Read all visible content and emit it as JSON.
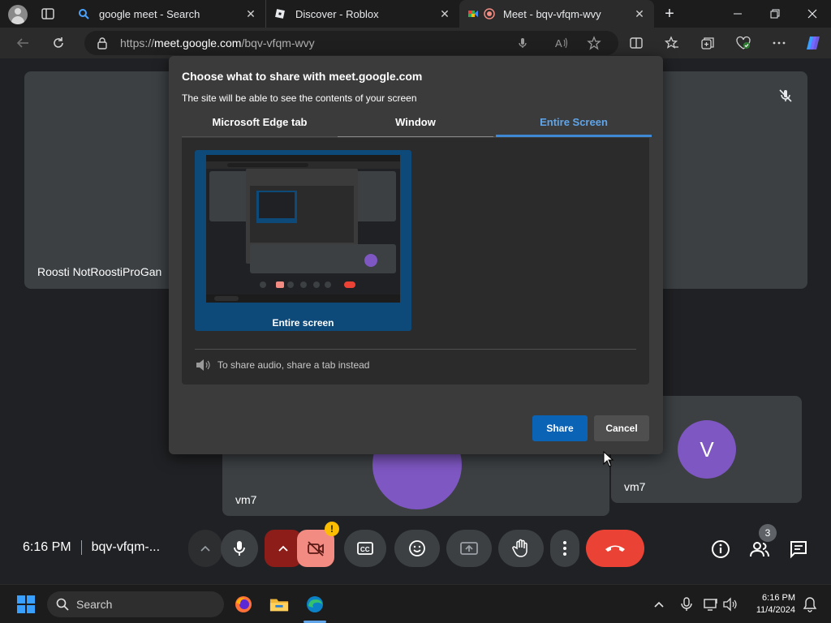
{
  "browser": {
    "tabs": [
      {
        "title": "google meet - Search",
        "icon": "bing-search-icon"
      },
      {
        "title": "Discover - Roblox",
        "icon": "roblox-icon"
      },
      {
        "title": "Meet - bqv-vfqm-wvy",
        "icon": "google-meet-icon",
        "active": true
      }
    ],
    "url_prefix": "https://",
    "url_host": "meet.google.com",
    "url_path": "/bqv-vfqm-wvy"
  },
  "meet": {
    "participants": [
      {
        "name": "Roosti NotRoostiProGan"
      },
      {
        "name": "vm7",
        "initial": "V"
      },
      {
        "name": "vm7"
      }
    ],
    "time": "6:16 PM",
    "meeting_code": "bqv-vfqm-...",
    "people_count": "3",
    "warning_badge": "!"
  },
  "share_dialog": {
    "title": "Choose what to share with meet.google.com",
    "subtitle": "The site will be able to see the contents of your screen",
    "tabs": [
      "Microsoft Edge tab",
      "Window",
      "Entire Screen"
    ],
    "active_tab": "Entire Screen",
    "source_label": "Entire screen",
    "audio_note": "To share audio, share a tab instead",
    "share_label": "Share",
    "cancel_label": "Cancel"
  },
  "taskbar": {
    "search_label": "Search",
    "time": "6:16 PM",
    "date": "11/4/2024"
  },
  "colors": {
    "accent_blue": "#0b63b6",
    "tab_active": "#60a5ea",
    "end_call_red": "#ea4335",
    "avatar_purple": "#7e57c2"
  }
}
